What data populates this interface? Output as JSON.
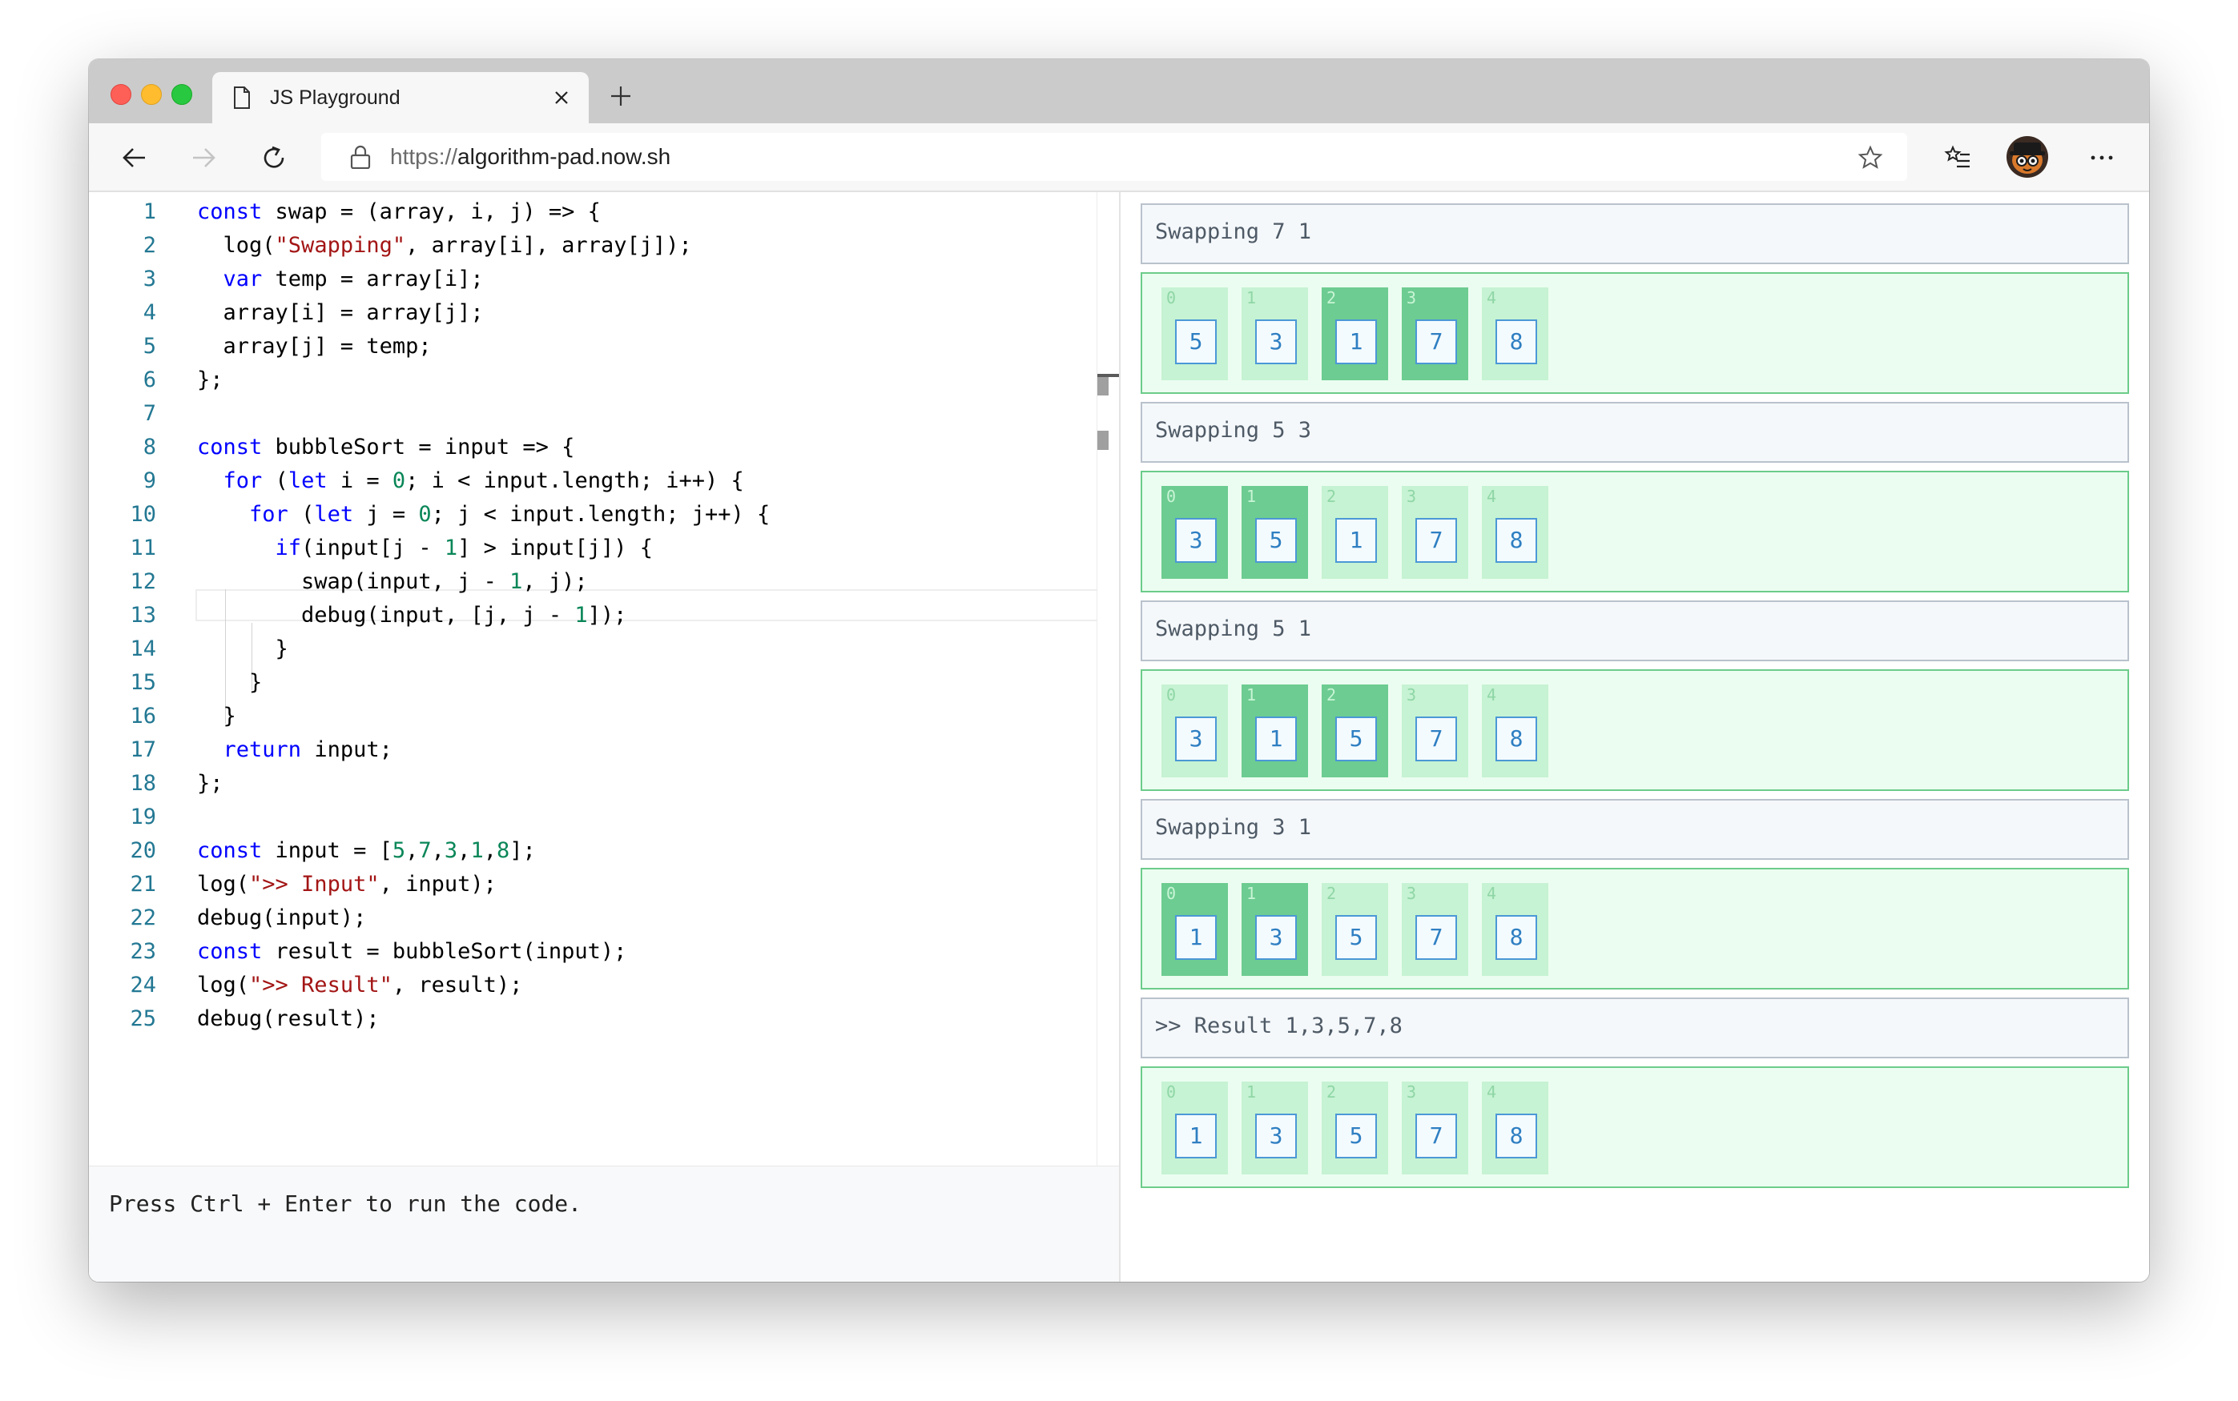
{
  "browser": {
    "tab_title": "JS Playground",
    "url_scheme": "https://",
    "url_host": "algorithm-pad.now.sh"
  },
  "editor": {
    "lines": [
      {
        "n": "1",
        "t": "const swap = (array, i, j) => {"
      },
      {
        "n": "2",
        "t": "  log(\"Swapping\", array[i], array[j]);"
      },
      {
        "n": "3",
        "t": "  var temp = array[i];"
      },
      {
        "n": "4",
        "t": "  array[i] = array[j];"
      },
      {
        "n": "5",
        "t": "  array[j] = temp;"
      },
      {
        "n": "6",
        "t": "};"
      },
      {
        "n": "7",
        "t": ""
      },
      {
        "n": "8",
        "t": "const bubbleSort = input => {"
      },
      {
        "n": "9",
        "t": "  for (let i = 0; i < input.length; i++) {"
      },
      {
        "n": "10",
        "t": "    for (let j = 0; j < input.length; j++) {"
      },
      {
        "n": "11",
        "t": "      if(input[j - 1] > input[j]) {"
      },
      {
        "n": "12",
        "t": "        swap(input, j - 1, j);"
      },
      {
        "n": "13",
        "t": "        debug(input, [j, j - 1]);"
      },
      {
        "n": "14",
        "t": "      }"
      },
      {
        "n": "15",
        "t": "    }"
      },
      {
        "n": "16",
        "t": "  }"
      },
      {
        "n": "17",
        "t": "  return input;"
      },
      {
        "n": "18",
        "t": "};"
      },
      {
        "n": "19",
        "t": ""
      },
      {
        "n": "20",
        "t": "const input = [5,7,3,1,8];"
      },
      {
        "n": "21",
        "t": "log(\">> Input\", input);"
      },
      {
        "n": "22",
        "t": "debug(input);"
      },
      {
        "n": "23",
        "t": "const result = bubbleSort(input);"
      },
      {
        "n": "24",
        "t": "log(\">> Result\", result);"
      },
      {
        "n": "25",
        "t": "debug(result);"
      }
    ],
    "status_text": "Press Ctrl + Enter to run the code."
  },
  "output": {
    "entries": [
      {
        "type": "log",
        "text": "Swapping 7 1"
      },
      {
        "type": "array",
        "cells": [
          {
            "i": "0",
            "v": "5",
            "hl": false
          },
          {
            "i": "1",
            "v": "3",
            "hl": false
          },
          {
            "i": "2",
            "v": "1",
            "hl": true
          },
          {
            "i": "3",
            "v": "7",
            "hl": true
          },
          {
            "i": "4",
            "v": "8",
            "hl": false
          }
        ]
      },
      {
        "type": "log",
        "text": "Swapping 5 3"
      },
      {
        "type": "array",
        "cells": [
          {
            "i": "0",
            "v": "3",
            "hl": true
          },
          {
            "i": "1",
            "v": "5",
            "hl": true
          },
          {
            "i": "2",
            "v": "1",
            "hl": false
          },
          {
            "i": "3",
            "v": "7",
            "hl": false
          },
          {
            "i": "4",
            "v": "8",
            "hl": false
          }
        ]
      },
      {
        "type": "log",
        "text": "Swapping 5 1"
      },
      {
        "type": "array",
        "cells": [
          {
            "i": "0",
            "v": "3",
            "hl": false
          },
          {
            "i": "1",
            "v": "1",
            "hl": true
          },
          {
            "i": "2",
            "v": "5",
            "hl": true
          },
          {
            "i": "3",
            "v": "7",
            "hl": false
          },
          {
            "i": "4",
            "v": "8",
            "hl": false
          }
        ]
      },
      {
        "type": "log",
        "text": "Swapping 3 1"
      },
      {
        "type": "array",
        "cells": [
          {
            "i": "0",
            "v": "1",
            "hl": true
          },
          {
            "i": "1",
            "v": "3",
            "hl": true
          },
          {
            "i": "2",
            "v": "5",
            "hl": false
          },
          {
            "i": "3",
            "v": "7",
            "hl": false
          },
          {
            "i": "4",
            "v": "8",
            "hl": false
          }
        ]
      },
      {
        "type": "log",
        "text": ">> Result 1,3,5,7,8"
      },
      {
        "type": "array",
        "cells": [
          {
            "i": "0",
            "v": "1",
            "hl": false
          },
          {
            "i": "1",
            "v": "3",
            "hl": false
          },
          {
            "i": "2",
            "v": "5",
            "hl": false
          },
          {
            "i": "3",
            "v": "7",
            "hl": false
          },
          {
            "i": "4",
            "v": "8",
            "hl": false
          }
        ]
      }
    ]
  },
  "colors": {
    "keyword": "#0000ff",
    "string": "#a31515",
    "number": "#098658",
    "line_number": "#237893",
    "cell_highlight": "#6dcc91",
    "cell_normal": "#c6f3d3"
  }
}
